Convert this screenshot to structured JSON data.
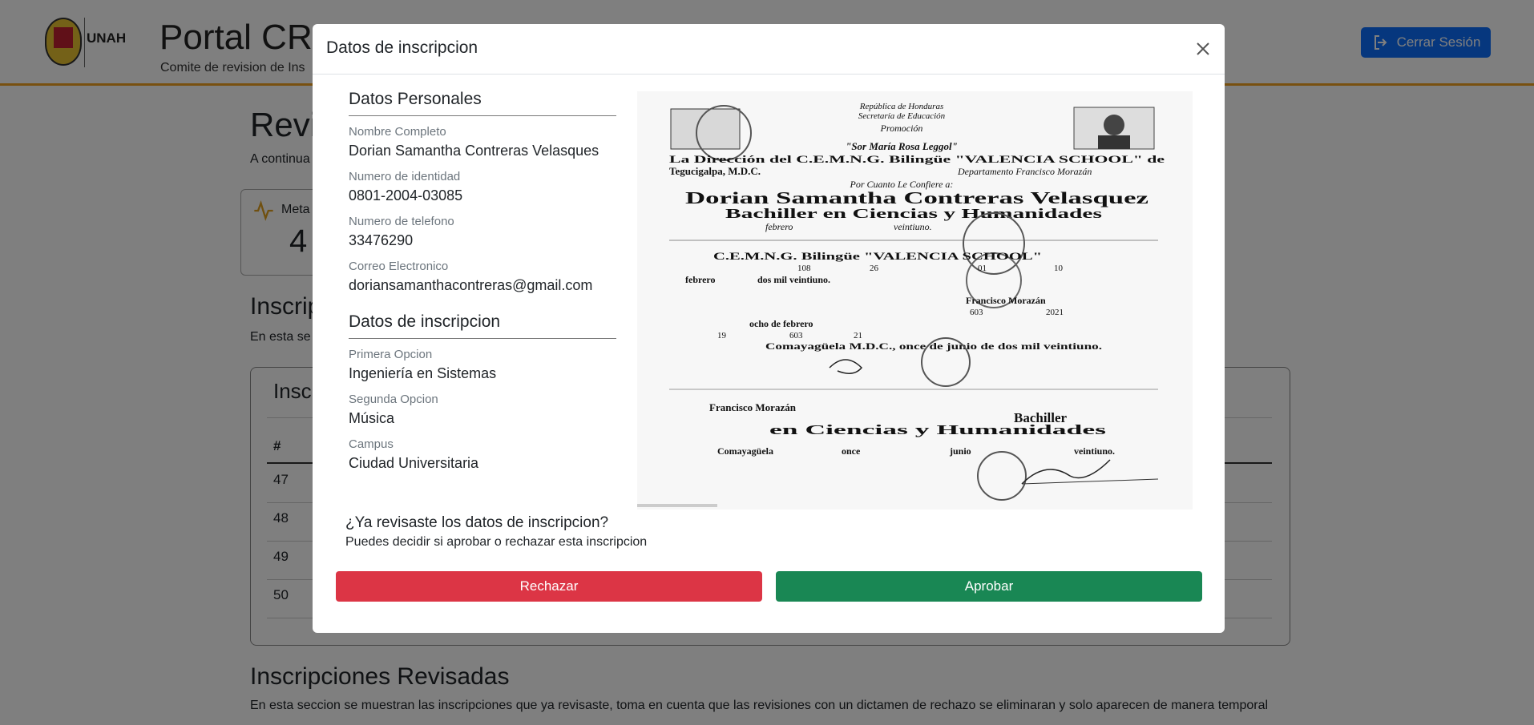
{
  "header": {
    "logo_text": "UNAH",
    "title": "Portal CRI",
    "subtitle": "Comite de revision de Ins",
    "logout_label": "Cerrar Sesión"
  },
  "background": {
    "heading": "Revi",
    "intro": "A continua",
    "stat_label": "Meta",
    "stat_value": "4",
    "pending_heading": "Inscrip",
    "pending_intro": "En esta se",
    "table_title": "Inscr",
    "table_col_hash": "#",
    "rows": [
      "47",
      "48",
      "49",
      "50"
    ],
    "reviewed_heading": "Inscripciones Revisadas",
    "reviewed_intro": "En esta seccion se muestran las inscripciones que ya revisaste, toma en cuenta que las revisiones con un dictamen de rechazo se eliminaran y solo aparecen de manera temporal"
  },
  "modal": {
    "title": "Datos de inscripcion",
    "personal": {
      "section_title": "Datos Personales",
      "name_label": "Nombre Completo",
      "name_value": "Dorian Samantha Contreras Velasques",
      "id_label": "Numero de identidad",
      "id_value": "0801-2004-03085",
      "phone_label": "Numero de telefono",
      "phone_value": "33476290",
      "email_label": "Correo Electronico",
      "email_value": "doriansamanthacontreras@gmail.com"
    },
    "enrollment": {
      "section_title": "Datos de inscripcion",
      "first_label": "Primera Opcion",
      "first_value": "Ingeniería en Sistemas",
      "second_label": "Segunda Opcion",
      "second_value": "Música",
      "campus_label": "Campus",
      "campus_value": "Ciudad Universitaria"
    },
    "certificate": {
      "lines": [
        "República de Honduras",
        "Secretaría de Educación",
        "Promoción",
        "\"Sor María Rosa Leggol\"",
        "La Dirección del C.E.M.N.G. Bilingüe \"VALENCIA SCHOOL\" de",
        "Tegucigalpa, M.D.C.",
        "Departamento Francisco Morazán",
        "Por Cuanto Le Confiere a:",
        "Dorian Samantha Contreras Velasquez",
        "Bachiller en Ciencias y Humanidades",
        "febrero",
        "veintiuno.",
        "C.E.M.N.G. Bilingüe \"VALENCIA SCHOOL\"",
        "108",
        "26",
        "01",
        "10",
        "febrero",
        "dos mil veintiuno.",
        "Francisco Morazán",
        "603",
        "2021",
        "ocho de febrero",
        "19",
        "603",
        "21",
        "Comayagüela M.D.C., once de junio de dos mil veintiuno.",
        "Francisco Morazán",
        "Bachiller",
        "en Ciencias y Humanidades",
        "Comayagüela",
        "once",
        "junio",
        "veintiuno."
      ]
    },
    "question_title": "¿Ya revisaste los datos de inscripcion?",
    "question_sub": "Puedes decidir si aprobar o rechazar esta inscripcion",
    "reject_label": "Rechazar",
    "approve_label": "Aprobar"
  }
}
